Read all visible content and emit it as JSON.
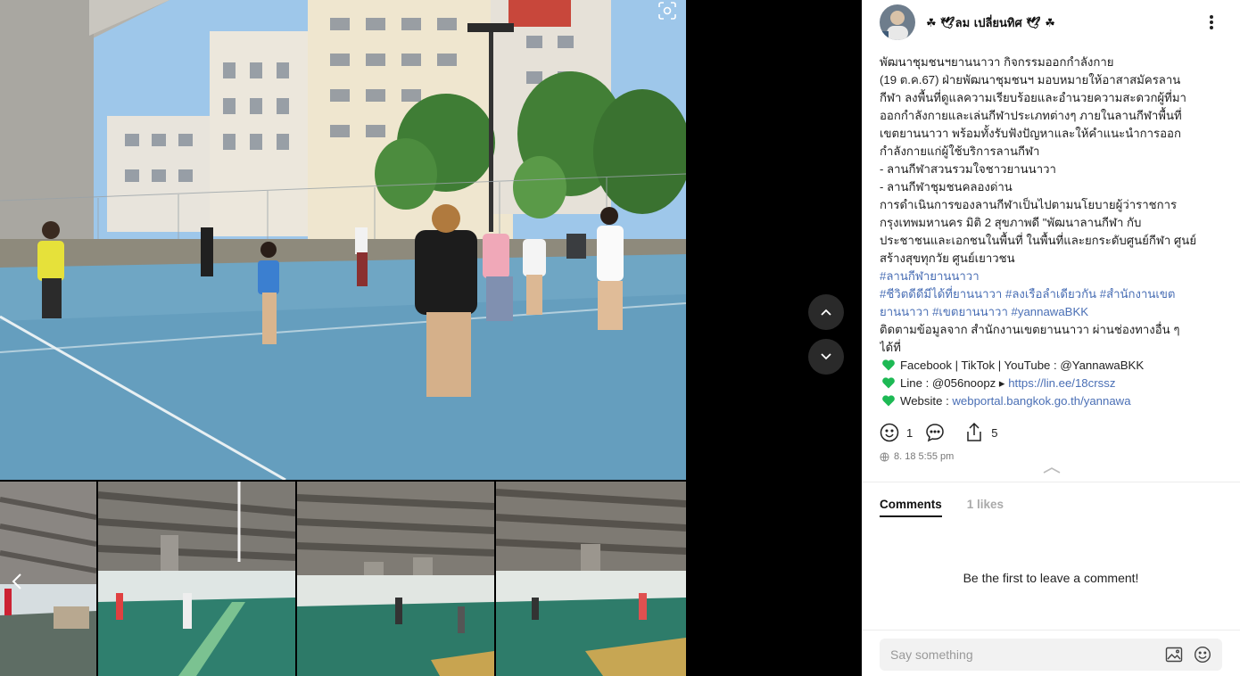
{
  "viewer": {
    "prev_label": "Previous image",
    "next_label": "Next image"
  },
  "post": {
    "author": "☘ 🕊ลม เปลี่ยนทิศ 🕊 ☘",
    "body_lines": [
      {
        "parts": [
          {
            "t": "text",
            "v": "พัฒนาชุมชนฯยานนาวา กิจกรรมออกกำลังกาย"
          }
        ]
      },
      {
        "parts": [
          {
            "t": "text",
            "v": " (19 ต.ค.67)  ฝ่ายพัฒนาชุมชนฯ มอบหมายให้อาสาสมัครลาน"
          }
        ]
      },
      {
        "parts": [
          {
            "t": "text",
            "v": "กีฬา ลงพื้นที่ดูแลความเรียบร้อยและอำนวยความสะดวกผู้ที่มา"
          }
        ]
      },
      {
        "parts": [
          {
            "t": "text",
            "v": "ออกกำลังกายและเล่นกีฬาประเภทต่างๆ ภายในลานกีฬาพื้นที่"
          }
        ]
      },
      {
        "parts": [
          {
            "t": "text",
            "v": "เขตยานนาวา พร้อมทั้งรับฟังปัญหาและให้คำแนะนำการออก"
          }
        ]
      },
      {
        "parts": [
          {
            "t": "text",
            "v": "กำลังกายแก่ผู้ใช้บริการลานกีฬา"
          }
        ]
      },
      {
        "parts": [
          {
            "t": "text",
            "v": "- ลานกีฬาสวนรวมใจชาวยานนาวา"
          }
        ]
      },
      {
        "parts": [
          {
            "t": "text",
            "v": "- ลานกีฬาชุมชนคลองด่าน"
          }
        ]
      },
      {
        "parts": [
          {
            "t": "text",
            "v": "   การดำเนินการของลานกีฬาเป็นไปตามนโยบายผู้ว่าราชการ"
          }
        ]
      },
      {
        "parts": [
          {
            "t": "text",
            "v": "กรุงเทพมหานคร  มิติ 2 สุขภาพดี  \"พัฒนาลานกีฬา กับ"
          }
        ]
      },
      {
        "parts": [
          {
            "t": "text",
            "v": "ประชาชนและเอกชนในพื้นที่ ในพื้นที่และยกระดับศูนย์กีฬา ศูนย์"
          }
        ]
      },
      {
        "parts": [
          {
            "t": "text",
            "v": "สร้างสุขทุกวัย ศูนย์เยาวชน"
          }
        ]
      },
      {
        "parts": [
          {
            "t": "tag",
            "v": "#ลานกีฬายานนาวา"
          }
        ]
      },
      {
        "parts": [
          {
            "t": "tag",
            "v": "#ชีวิตดีดีมีได้ที่ยานนาวา"
          },
          {
            "t": "text",
            "v": " "
          },
          {
            "t": "tag",
            "v": "#ลงเรือลำเดียวกัน"
          },
          {
            "t": "text",
            "v": " "
          },
          {
            "t": "tag",
            "v": "#สำนักงานเขต"
          }
        ]
      },
      {
        "parts": [
          {
            "t": "tag",
            "v": "ยานนาวา"
          },
          {
            "t": "text",
            "v": " "
          },
          {
            "t": "tag",
            "v": "#เขตยานนาวา"
          },
          {
            "t": "text",
            "v": " "
          },
          {
            "t": "tag",
            "v": "#yannawaBKK"
          }
        ]
      },
      {
        "parts": [
          {
            "t": "text",
            "v": "ติดตามข้อมูลจาก สำนักงานเขตยานนาวา ผ่านช่องทางอื่น ๆ"
          }
        ]
      },
      {
        "parts": [
          {
            "t": "text",
            "v": "ได้ที่"
          }
        ]
      },
      {
        "parts": [
          {
            "t": "heart",
            "v": "green-heart-icon"
          },
          {
            "t": "text",
            "v": "Facebook | TikTok | YouTube : @YannawaBKK"
          }
        ]
      },
      {
        "parts": [
          {
            "t": "heart",
            "v": "green-heart-icon"
          },
          {
            "t": "text",
            "v": "Line : @056noopz ▸ "
          },
          {
            "t": "link",
            "v": "https://lin.ee/18crssz"
          }
        ]
      },
      {
        "parts": [
          {
            "t": "heart",
            "v": "green-heart-icon"
          },
          {
            "t": "text",
            "v": "Website : "
          },
          {
            "t": "link",
            "v": "webportal.bangkok.go.th/yannawa"
          }
        ]
      }
    ],
    "reactions_count": "1",
    "shares_count": "5",
    "timestamp": "8. 18 5:55 pm",
    "accent_color": "#4a6fb5",
    "heart_color": "#1db954"
  },
  "comments": {
    "tab_comments": "Comments",
    "tab_likes": "1 likes",
    "empty_message": "Be the first to leave a comment!",
    "input_placeholder": "Say something"
  }
}
